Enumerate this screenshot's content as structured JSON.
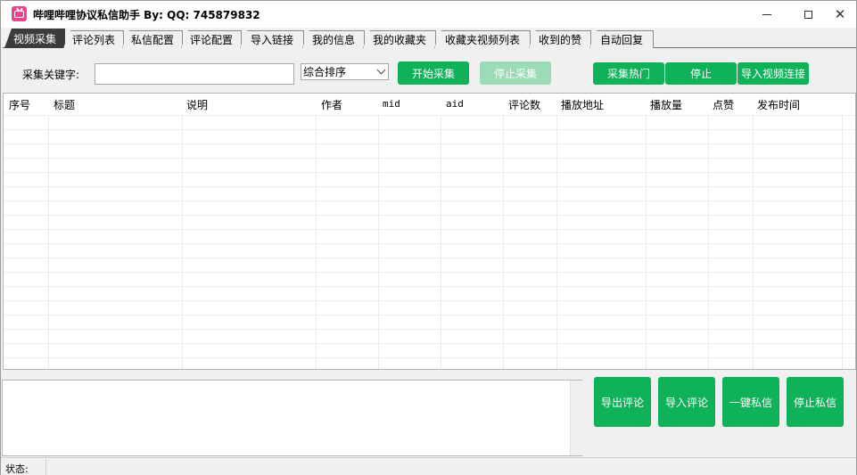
{
  "window": {
    "title": "哔哩哔哩协议私信助手 By:  QQ:  745879832"
  },
  "tabs": [
    {
      "label": "视频采集",
      "active": true
    },
    {
      "label": "评论列表"
    },
    {
      "label": "私信配置"
    },
    {
      "label": "评论配置"
    },
    {
      "label": "导入链接"
    },
    {
      "label": "我的信息"
    },
    {
      "label": "我的收藏夹"
    },
    {
      "label": "收藏夹视频列表"
    },
    {
      "label": "收到的赞"
    },
    {
      "label": "自动回复"
    }
  ],
  "search": {
    "label": "采集关键字:",
    "value": "",
    "sort_selected": "综合排序"
  },
  "toolbar": {
    "start_label": "开始采集",
    "stop_label": "停止采集",
    "hot_label": "采集热门",
    "stop2_label": "停止",
    "import_video_label": "导入视频连接"
  },
  "table": {
    "columns": [
      "序号",
      "标题",
      "说明",
      "作者",
      "mid",
      "aid",
      "评论数",
      "播放地址",
      "播放量",
      "点赞",
      "发布时间"
    ],
    "rows": []
  },
  "actions": {
    "export_comments": "导出评论",
    "import_comments": "导入评论",
    "one_click_dm": "一键私信",
    "stop_dm": "停止私信"
  },
  "status": {
    "label": "状态:",
    "value": ""
  },
  "colors": {
    "accent_green": "#0fb259",
    "disabled_green": "#9bdbb6",
    "active_tab": "#3c3c3c",
    "app_icon": "#e8448e"
  }
}
